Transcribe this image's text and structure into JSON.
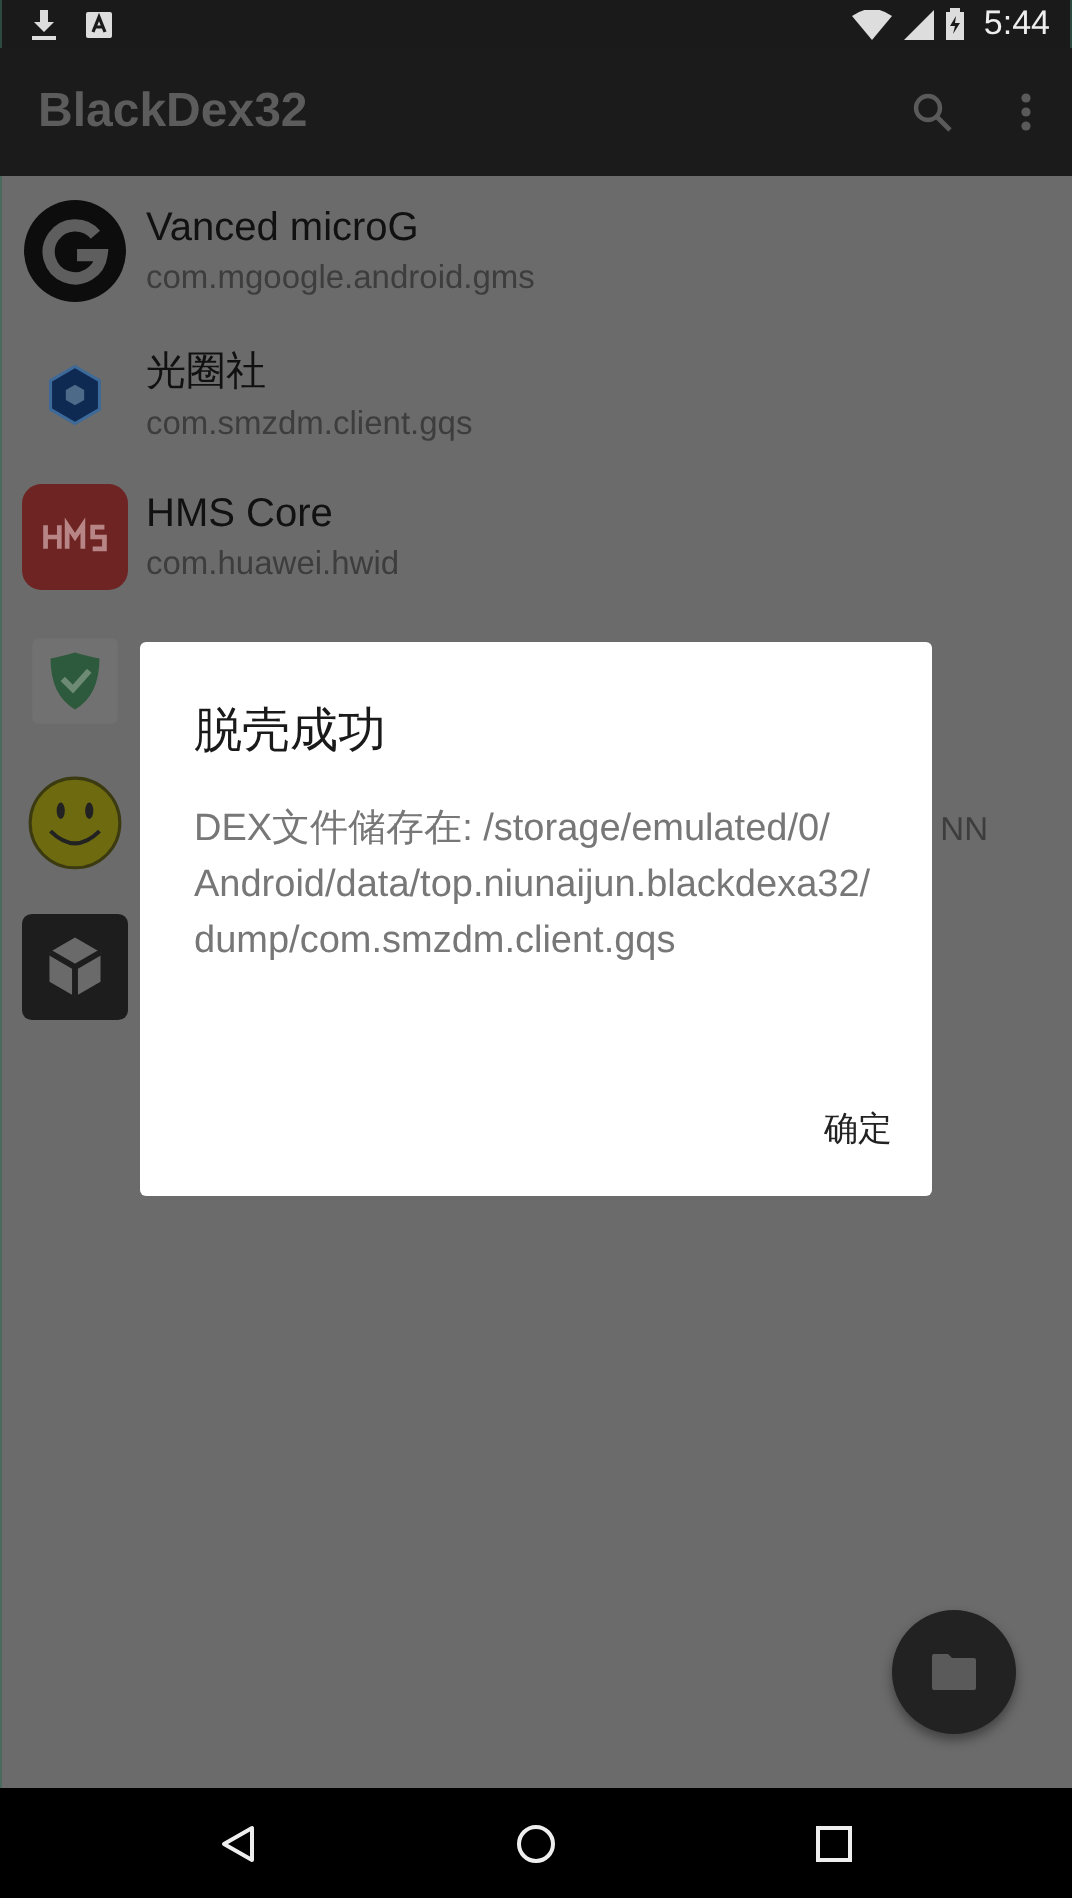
{
  "status_bar": {
    "time": "5:44"
  },
  "toolbar": {
    "title": "BlackDex32"
  },
  "apps": [
    {
      "kind": "app",
      "name": "Vanced microG",
      "package": "com.mgoogle.android.gms"
    },
    {
      "kind": "app",
      "name": "光圈社",
      "package": "com.smzdm.client.gqs"
    },
    {
      "kind": "app",
      "name": "HMS Core",
      "package": "com.huawei.hwid"
    },
    {
      "kind": "app"
    },
    {
      "kind": "app",
      "trailing": "NN"
    },
    {
      "kind": "app"
    }
  ],
  "dialog": {
    "title": "脱壳成功",
    "message": "DEX文件储存在: /storage/emulated/0/Android/data/top.niunaijun.blackdexa32/dump/com.smzdm.client.gqs",
    "button": "确定"
  }
}
